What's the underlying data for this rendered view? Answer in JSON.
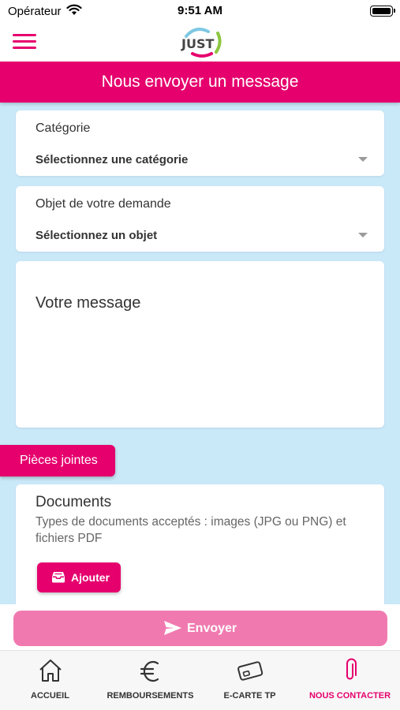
{
  "status_bar": {
    "carrier": "Opérateur",
    "time": "9:51 AM"
  },
  "header": {
    "logo_text": "JUST"
  },
  "page": {
    "title": "Nous envoyer un message"
  },
  "form": {
    "category": {
      "label": "Catégorie",
      "value": "Sélectionnez une catégorie"
    },
    "subject": {
      "label": "Objet de votre demande",
      "value": "Sélectionnez un objet"
    },
    "message": {
      "placeholder": "Votre message"
    }
  },
  "attachments": {
    "section_label": "Pièces jointes",
    "documents_title": "Documents",
    "documents_desc": "Types de documents acceptés : images (JPG ou PNG) et fichiers PDF",
    "add_label": "Ajouter"
  },
  "send": {
    "label": "Envoyer"
  },
  "tabs": [
    {
      "label": "ACCUEIL",
      "icon": "home-icon",
      "active": false
    },
    {
      "label": "REMBOURSEMENTS",
      "icon": "euro-icon",
      "active": false
    },
    {
      "label": "E-CARTE TP",
      "icon": "card-icon",
      "active": false
    },
    {
      "label": "NOUS CONTACTER",
      "icon": "paperclip-icon",
      "active": true
    }
  ],
  "colors": {
    "accent": "#e5006d",
    "accent_light": "#f07ab0",
    "background": "#c9e8f8"
  }
}
